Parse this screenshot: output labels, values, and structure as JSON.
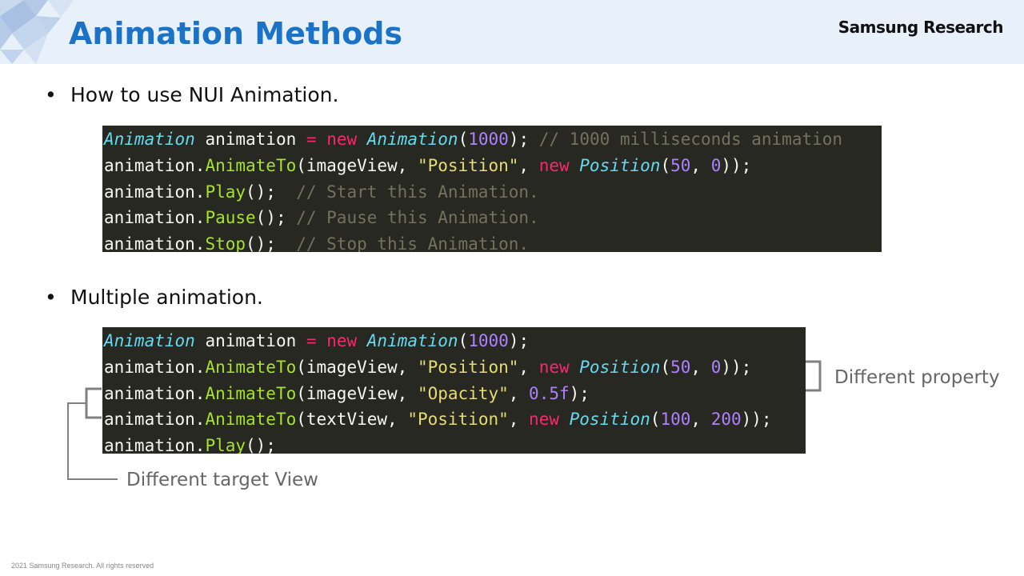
{
  "header": {
    "title": "Animation Methods",
    "brand": "Samsung Research"
  },
  "bullets": [
    {
      "marker": "•",
      "text": "How to use NUI Animation."
    },
    {
      "marker": "•",
      "text": "Multiple animation."
    }
  ],
  "code1": [
    [
      [
        "cls",
        "Animation"
      ],
      [
        "pl",
        " animation "
      ],
      [
        "kw",
        "="
      ],
      [
        "pl",
        " "
      ],
      [
        "kw",
        "new"
      ],
      [
        "pl",
        " "
      ],
      [
        "cls",
        "Animation"
      ],
      [
        "pl",
        "("
      ],
      [
        "num",
        "1000"
      ],
      [
        "pl",
        "); "
      ],
      [
        "cm",
        "// 1000 milliseconds animation"
      ]
    ],
    [
      [
        "pl",
        "animation."
      ],
      [
        "fn",
        "AnimateTo"
      ],
      [
        "pl",
        "(imageView, "
      ],
      [
        "str",
        "\"Position\""
      ],
      [
        "pl",
        ", "
      ],
      [
        "kw",
        "new"
      ],
      [
        "pl",
        " "
      ],
      [
        "cls",
        "Position"
      ],
      [
        "pl",
        "("
      ],
      [
        "num",
        "50"
      ],
      [
        "pl",
        ", "
      ],
      [
        "num",
        "0"
      ],
      [
        "pl",
        "));"
      ]
    ],
    [
      [
        "pl",
        "animation."
      ],
      [
        "fn",
        "Play"
      ],
      [
        "pl",
        "();  "
      ],
      [
        "cm",
        "// Start this Animation."
      ]
    ],
    [
      [
        "pl",
        "animation."
      ],
      [
        "fn",
        "Pause"
      ],
      [
        "pl",
        "(); "
      ],
      [
        "cm",
        "// Pause this Animation."
      ]
    ],
    [
      [
        "pl",
        "animation."
      ],
      [
        "fn",
        "Stop"
      ],
      [
        "pl",
        "();  "
      ],
      [
        "cm",
        "// Stop this Animation."
      ]
    ]
  ],
  "code2": [
    [
      [
        "cls",
        "Animation"
      ],
      [
        "pl",
        " animation "
      ],
      [
        "kw",
        "="
      ],
      [
        "pl",
        " "
      ],
      [
        "kw",
        "new"
      ],
      [
        "pl",
        " "
      ],
      [
        "cls",
        "Animation"
      ],
      [
        "pl",
        "("
      ],
      [
        "num",
        "1000"
      ],
      [
        "pl",
        ");"
      ]
    ],
    [
      [
        "pl",
        "animation."
      ],
      [
        "fn",
        "AnimateTo"
      ],
      [
        "pl",
        "(imageView, "
      ],
      [
        "str",
        "\"Position\""
      ],
      [
        "pl",
        ", "
      ],
      [
        "kw",
        "new"
      ],
      [
        "pl",
        " "
      ],
      [
        "cls",
        "Position"
      ],
      [
        "pl",
        "("
      ],
      [
        "num",
        "50"
      ],
      [
        "pl",
        ", "
      ],
      [
        "num",
        "0"
      ],
      [
        "pl",
        "));"
      ]
    ],
    [
      [
        "pl",
        "animation."
      ],
      [
        "fn",
        "AnimateTo"
      ],
      [
        "pl",
        "(imageView, "
      ],
      [
        "str",
        "\"Opacity\""
      ],
      [
        "pl",
        ", "
      ],
      [
        "num",
        "0.5f"
      ],
      [
        "pl",
        ");"
      ]
    ],
    [
      [
        "pl",
        "animation."
      ],
      [
        "fn",
        "AnimateTo"
      ],
      [
        "pl",
        "(textView, "
      ],
      [
        "str",
        "\"Position\""
      ],
      [
        "pl",
        ", "
      ],
      [
        "kw",
        "new"
      ],
      [
        "pl",
        " "
      ],
      [
        "cls",
        "Position"
      ],
      [
        "pl",
        "("
      ],
      [
        "num",
        "100"
      ],
      [
        "pl",
        ", "
      ],
      [
        "num",
        "200"
      ],
      [
        "pl",
        "));"
      ]
    ],
    [
      [
        "pl",
        "animation."
      ],
      [
        "fn",
        "Play"
      ],
      [
        "pl",
        "();"
      ]
    ]
  ],
  "annotations": {
    "property": "Different property",
    "target": "Different target View"
  },
  "footer": "2021 Samsung Research. All rights reserved",
  "colors": {
    "title": "#1a73c7",
    "header_bg": "#e8f0fa",
    "code_bg": "#272822",
    "bracket": "#808080"
  }
}
